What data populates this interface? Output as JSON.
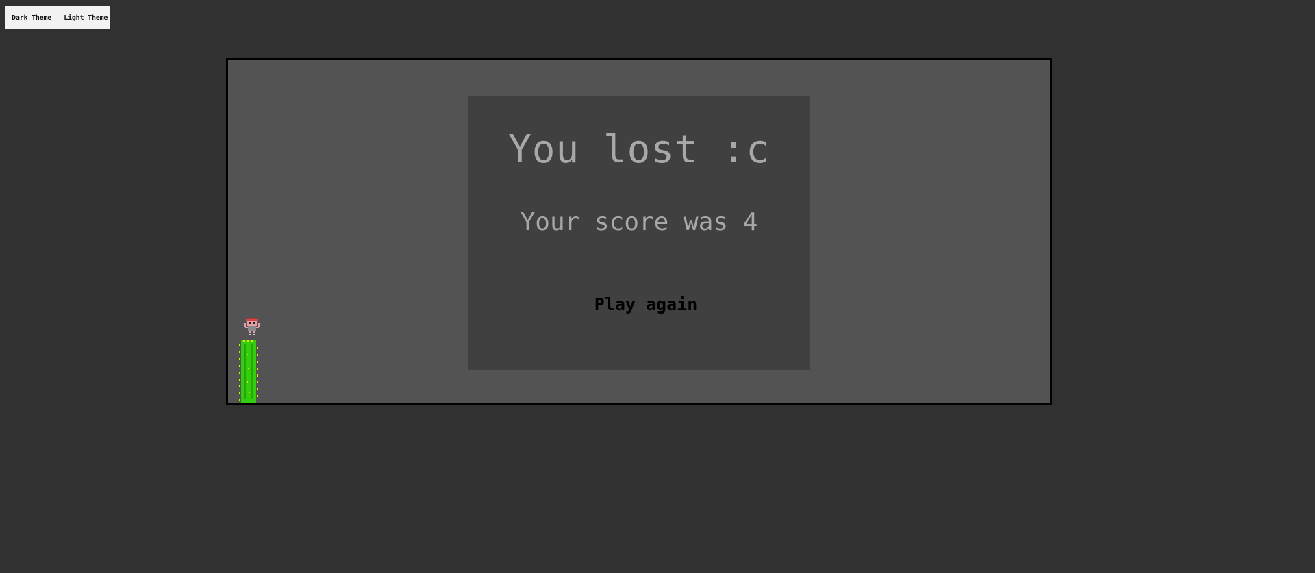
{
  "theme_switcher": {
    "dark_label": "Dark Theme",
    "light_label": "Light Theme"
  },
  "game": {
    "over_title": "You lost :c",
    "score_text": "Your score was 4",
    "score": 4,
    "play_again_label": "Play again"
  },
  "colors": {
    "page_background": "#313131",
    "game_background": "#535353",
    "modal_background": "#404040",
    "cactus_green": "#33cc11",
    "cactus_spikes": "#e6e600",
    "player_skin": "#e8a0a8",
    "player_hat": "#b83030"
  },
  "icons": {
    "obstacle": "cactus-icon",
    "player": "player-character-icon"
  }
}
